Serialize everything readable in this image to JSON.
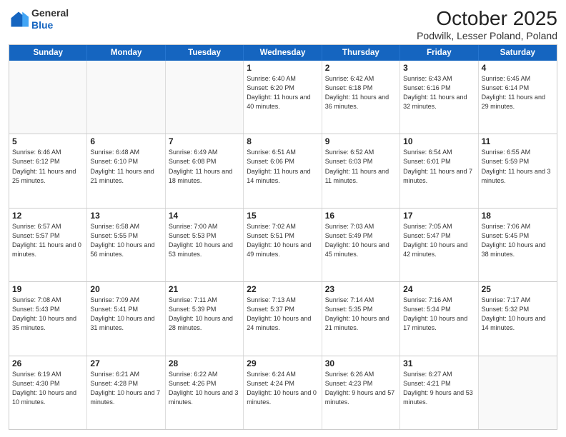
{
  "logo": {
    "general": "General",
    "blue": "Blue"
  },
  "title": "October 2025",
  "subtitle": "Podwilk, Lesser Poland, Poland",
  "header_days": [
    "Sunday",
    "Monday",
    "Tuesday",
    "Wednesday",
    "Thursday",
    "Friday",
    "Saturday"
  ],
  "weeks": [
    [
      {
        "day": "",
        "info": "",
        "shaded": true,
        "empty": true
      },
      {
        "day": "",
        "info": "",
        "shaded": true,
        "empty": true
      },
      {
        "day": "",
        "info": "",
        "shaded": true,
        "empty": true
      },
      {
        "day": "1",
        "info": "Sunrise: 6:40 AM\nSunset: 6:20 PM\nDaylight: 11 hours\nand 40 minutes."
      },
      {
        "day": "2",
        "info": "Sunrise: 6:42 AM\nSunset: 6:18 PM\nDaylight: 11 hours\nand 36 minutes."
      },
      {
        "day": "3",
        "info": "Sunrise: 6:43 AM\nSunset: 6:16 PM\nDaylight: 11 hours\nand 32 minutes."
      },
      {
        "day": "4",
        "info": "Sunrise: 6:45 AM\nSunset: 6:14 PM\nDaylight: 11 hours\nand 29 minutes."
      }
    ],
    [
      {
        "day": "5",
        "info": "Sunrise: 6:46 AM\nSunset: 6:12 PM\nDaylight: 11 hours\nand 25 minutes."
      },
      {
        "day": "6",
        "info": "Sunrise: 6:48 AM\nSunset: 6:10 PM\nDaylight: 11 hours\nand 21 minutes."
      },
      {
        "day": "7",
        "info": "Sunrise: 6:49 AM\nSunset: 6:08 PM\nDaylight: 11 hours\nand 18 minutes."
      },
      {
        "day": "8",
        "info": "Sunrise: 6:51 AM\nSunset: 6:06 PM\nDaylight: 11 hours\nand 14 minutes."
      },
      {
        "day": "9",
        "info": "Sunrise: 6:52 AM\nSunset: 6:03 PM\nDaylight: 11 hours\nand 11 minutes."
      },
      {
        "day": "10",
        "info": "Sunrise: 6:54 AM\nSunset: 6:01 PM\nDaylight: 11 hours\nand 7 minutes."
      },
      {
        "day": "11",
        "info": "Sunrise: 6:55 AM\nSunset: 5:59 PM\nDaylight: 11 hours\nand 3 minutes."
      }
    ],
    [
      {
        "day": "12",
        "info": "Sunrise: 6:57 AM\nSunset: 5:57 PM\nDaylight: 11 hours\nand 0 minutes."
      },
      {
        "day": "13",
        "info": "Sunrise: 6:58 AM\nSunset: 5:55 PM\nDaylight: 10 hours\nand 56 minutes."
      },
      {
        "day": "14",
        "info": "Sunrise: 7:00 AM\nSunset: 5:53 PM\nDaylight: 10 hours\nand 53 minutes."
      },
      {
        "day": "15",
        "info": "Sunrise: 7:02 AM\nSunset: 5:51 PM\nDaylight: 10 hours\nand 49 minutes."
      },
      {
        "day": "16",
        "info": "Sunrise: 7:03 AM\nSunset: 5:49 PM\nDaylight: 10 hours\nand 45 minutes."
      },
      {
        "day": "17",
        "info": "Sunrise: 7:05 AM\nSunset: 5:47 PM\nDaylight: 10 hours\nand 42 minutes."
      },
      {
        "day": "18",
        "info": "Sunrise: 7:06 AM\nSunset: 5:45 PM\nDaylight: 10 hours\nand 38 minutes."
      }
    ],
    [
      {
        "day": "19",
        "info": "Sunrise: 7:08 AM\nSunset: 5:43 PM\nDaylight: 10 hours\nand 35 minutes."
      },
      {
        "day": "20",
        "info": "Sunrise: 7:09 AM\nSunset: 5:41 PM\nDaylight: 10 hours\nand 31 minutes."
      },
      {
        "day": "21",
        "info": "Sunrise: 7:11 AM\nSunset: 5:39 PM\nDaylight: 10 hours\nand 28 minutes."
      },
      {
        "day": "22",
        "info": "Sunrise: 7:13 AM\nSunset: 5:37 PM\nDaylight: 10 hours\nand 24 minutes."
      },
      {
        "day": "23",
        "info": "Sunrise: 7:14 AM\nSunset: 5:35 PM\nDaylight: 10 hours\nand 21 minutes."
      },
      {
        "day": "24",
        "info": "Sunrise: 7:16 AM\nSunset: 5:34 PM\nDaylight: 10 hours\nand 17 minutes."
      },
      {
        "day": "25",
        "info": "Sunrise: 7:17 AM\nSunset: 5:32 PM\nDaylight: 10 hours\nand 14 minutes."
      }
    ],
    [
      {
        "day": "26",
        "info": "Sunrise: 6:19 AM\nSunset: 4:30 PM\nDaylight: 10 hours\nand 10 minutes."
      },
      {
        "day": "27",
        "info": "Sunrise: 6:21 AM\nSunset: 4:28 PM\nDaylight: 10 hours\nand 7 minutes."
      },
      {
        "day": "28",
        "info": "Sunrise: 6:22 AM\nSunset: 4:26 PM\nDaylight: 10 hours\nand 3 minutes."
      },
      {
        "day": "29",
        "info": "Sunrise: 6:24 AM\nSunset: 4:24 PM\nDaylight: 10 hours\nand 0 minutes."
      },
      {
        "day": "30",
        "info": "Sunrise: 6:26 AM\nSunset: 4:23 PM\nDaylight: 9 hours\nand 57 minutes."
      },
      {
        "day": "31",
        "info": "Sunrise: 6:27 AM\nSunset: 4:21 PM\nDaylight: 9 hours\nand 53 minutes."
      },
      {
        "day": "",
        "info": "",
        "shaded": true,
        "empty": true
      }
    ]
  ]
}
